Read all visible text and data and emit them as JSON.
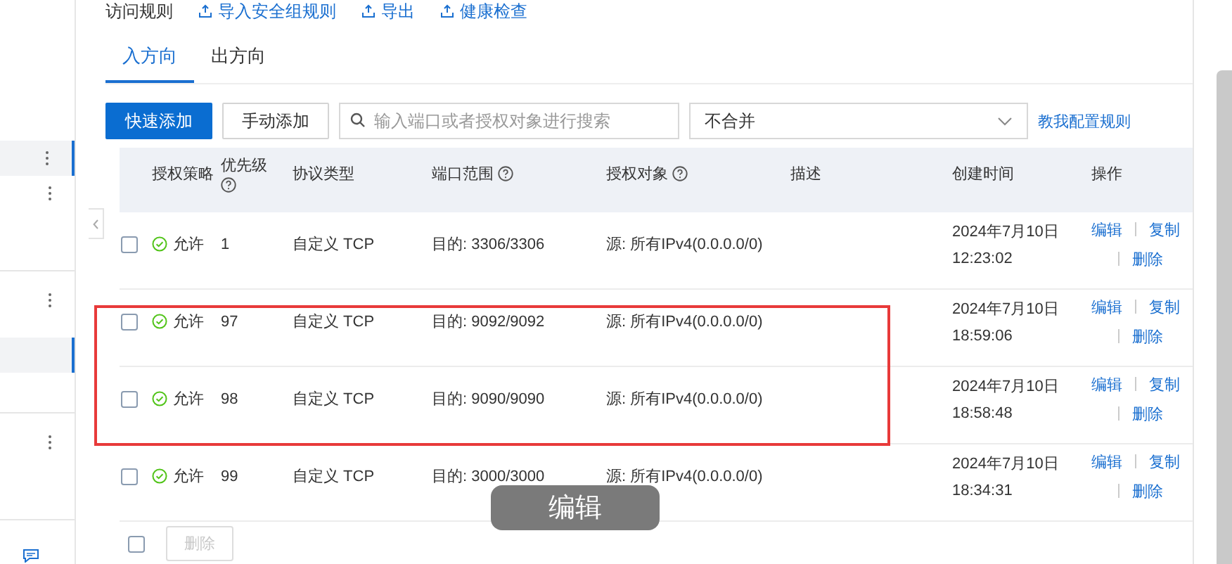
{
  "sidebar": {
    "items": [
      {
        "selected": true,
        "menu": true,
        "divider_after": false
      },
      {
        "selected": false,
        "menu": true,
        "divider_after": true
      },
      {
        "selected": false,
        "menu": true,
        "divider_after": false
      },
      {
        "selected": true,
        "menu": false,
        "divider_after": true
      },
      {
        "selected": false,
        "menu": true,
        "divider_after": true
      }
    ]
  },
  "header": {
    "title": "访问规则",
    "links": [
      "导入安全组规则",
      "导出",
      "健康检查"
    ]
  },
  "tabs": [
    {
      "label": "入方向",
      "selected": true
    },
    {
      "label": "出方向",
      "selected": false
    }
  ],
  "toolbar": {
    "buttons": [
      {
        "label": "快速添加",
        "kind": "primary"
      },
      {
        "label": "手动添加",
        "kind": "default"
      }
    ],
    "search": {
      "placeholder": "输入端口或者授权对象进行搜索"
    },
    "select": {
      "value": "不合并"
    },
    "link": "教我配置规则"
  },
  "table": {
    "columns": [
      {
        "label": "授权策略",
        "help": false
      },
      {
        "label": "优先级",
        "help": true
      },
      {
        "label": "协议类型",
        "help": false
      },
      {
        "label": "端口范围",
        "help": true
      },
      {
        "label": "授权对象",
        "help": true
      },
      {
        "label": "描述",
        "help": false
      },
      {
        "label": "创建时间",
        "help": false
      },
      {
        "label": "操作",
        "help": false
      }
    ],
    "rows": [
      {
        "checked": false,
        "highlighted": false,
        "policy": "允许",
        "priority": "1",
        "protocol": "自定义 TCP",
        "port": "目的: 3306/3306",
        "object": "源: 所有IPv4(0.0.0.0/0)",
        "date": "2024年7月10日",
        "time": "12:23:02",
        "actions": [
          "编辑",
          "复制",
          "删除"
        ]
      },
      {
        "checked": false,
        "highlighted": true,
        "policy": "允许",
        "priority": "97",
        "protocol": "自定义 TCP",
        "port": "目的: 9092/9092",
        "object": "源: 所有IPv4(0.0.0.0/0)",
        "date": "2024年7月10日",
        "time": "18:59:06",
        "actions": [
          "编辑",
          "复制",
          "删除"
        ]
      },
      {
        "checked": false,
        "highlighted": true,
        "policy": "允许",
        "priority": "98",
        "protocol": "自定义 TCP",
        "port": "目的: 9090/9090",
        "object": "源: 所有IPv4(0.0.0.0/0)",
        "date": "2024年7月10日",
        "time": "18:58:48",
        "actions": [
          "编辑",
          "复制",
          "删除"
        ]
      },
      {
        "checked": false,
        "highlighted": false,
        "policy": "允许",
        "priority": "99",
        "protocol": "自定义 TCP",
        "port": "目的: 3000/3000",
        "object": "源: 所有IPv4(0.0.0.0/0)",
        "date": "2024年7月10日",
        "time": "18:34:31",
        "actions": [
          "编辑",
          "复制",
          "删除"
        ]
      }
    ]
  },
  "footer": {
    "checked": false,
    "button": {
      "label": "删除",
      "disabled": true
    }
  },
  "toast": "编辑"
}
